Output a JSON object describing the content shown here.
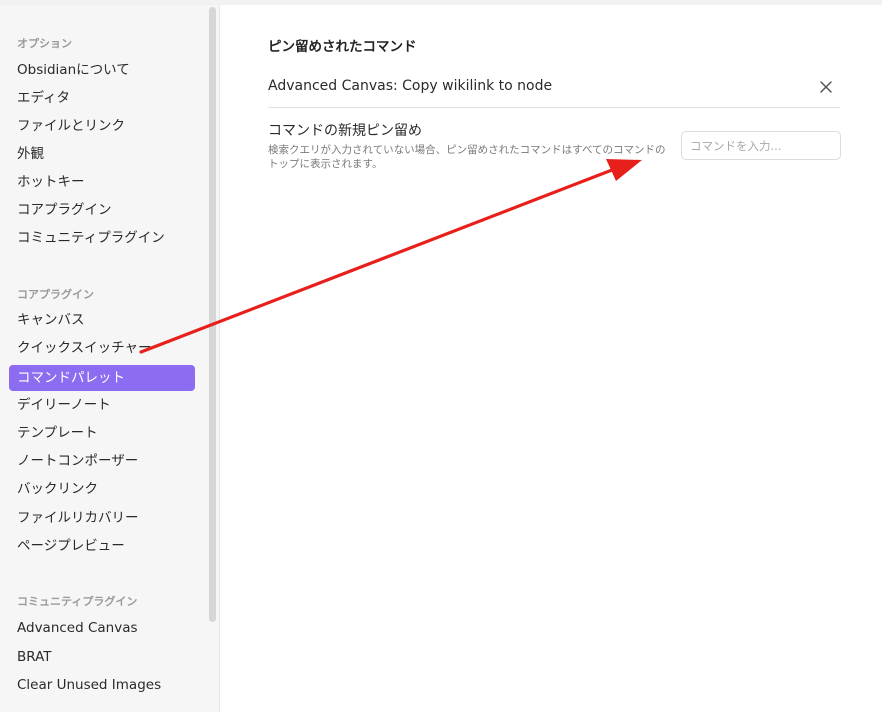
{
  "sidebar": {
    "sections": [
      {
        "title": "オプション",
        "items": [
          "Obsidianについて",
          "エディタ",
          "ファイルとリンク",
          "外観",
          "ホットキー",
          "コアプラグイン",
          "コミュニティプラグイン"
        ]
      },
      {
        "title": "コアプラグイン",
        "items": [
          "キャンバス",
          "クイックスイッチャー",
          "コマンドパレット",
          "デイリーノート",
          "テンプレート",
          "ノートコンポーザー",
          "バックリンク",
          "ファイルリカバリー",
          "ページプレビュー"
        ]
      },
      {
        "title": "コミュニティプラグイン",
        "items": [
          "Advanced Canvas",
          "BRAT",
          "Clear Unused Images"
        ]
      }
    ],
    "active_item": "コマンドパレット"
  },
  "main": {
    "heading": "ピン留めされたコマンド",
    "pinned_commands": [
      "Advanced Canvas: Copy wikilink to node"
    ],
    "new_pin": {
      "name": "コマンドの新規ピン留め",
      "description": "検索クエリが入力されていない場合、ピン留めされたコマンドはすべてのコマンドのトップに表示されます。",
      "input_placeholder": "コマンドを入力...",
      "input_value": ""
    }
  },
  "colors": {
    "accent": "#8c6cf0",
    "annotation_arrow": "#e8201c"
  },
  "icons": {
    "remove_pinned": "close-icon"
  }
}
